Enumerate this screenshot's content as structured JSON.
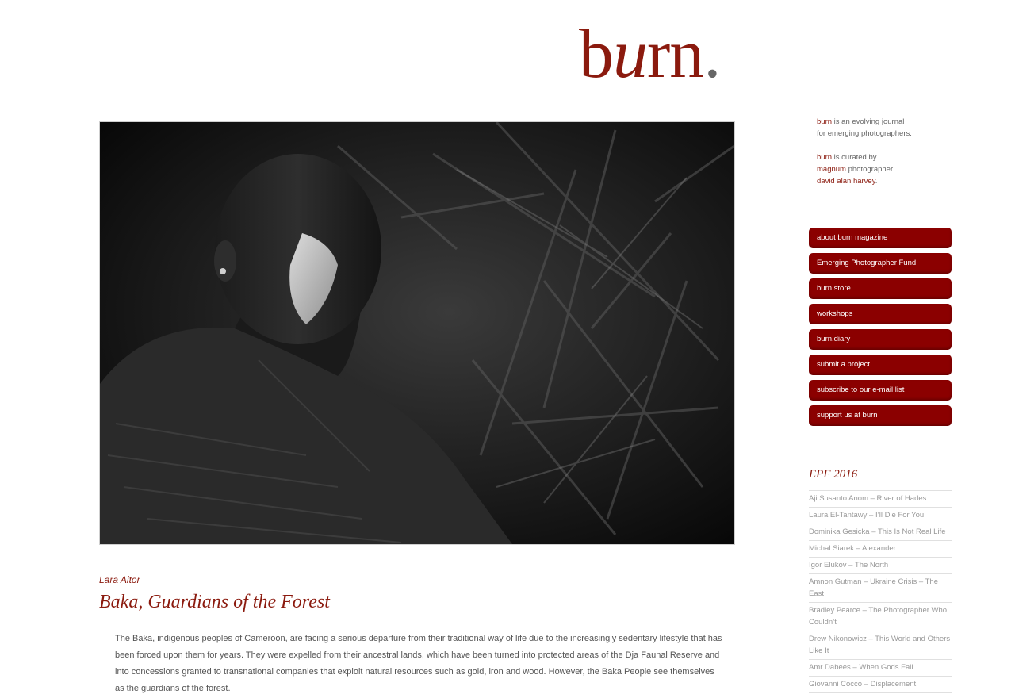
{
  "logo": {
    "b": "b",
    "u": "u",
    "rn": "rn",
    "dot": "."
  },
  "photo": {
    "alt": "Baka man in the forest"
  },
  "story": {
    "author": "Lara Aitor",
    "title": "Baka, Guardians of the Forest",
    "description": "The Baka, indigenous peoples of Cameroon, are facing a serious departure from their traditional way of life due to the increasingly sedentary lifestyle that has been forced upon them for years. They were expelled from their ancestral lands, which have been turned into protected areas of the Dja Faunal Reserve and into concessions granted to transnational companies that exploit natural resources such as gold, iron and wood. However, the Baka People see themselves as the guardians of the forest."
  },
  "intro": {
    "p1_link": "burn",
    "p1_text_a": " is an evolving journal",
    "p1_text_b": "for emerging photographers.",
    "p2_link1": "burn",
    "p2_text1": " is curated by",
    "p2_link2": "magnum",
    "p2_text2": " photographer",
    "p2_link3": "david alan harvey",
    "p2_text3": "."
  },
  "nav": {
    "items": [
      {
        "label": "about burn magazine"
      },
      {
        "label": "Emerging Photographer Fund"
      },
      {
        "label": "burn.store"
      },
      {
        "label": "workshops"
      },
      {
        "label": "burn.diary"
      },
      {
        "label": "submit a project"
      },
      {
        "label": "subscribe to our e-mail list"
      },
      {
        "label": "support us at burn"
      }
    ]
  },
  "epf": {
    "title": "EPF 2016",
    "items": [
      {
        "label": "Aji Susanto Anom – River of Hades"
      },
      {
        "label": "Laura El-Tantawy – I’ll Die For You"
      },
      {
        "label": "Dominika Gesicka – This Is Not Real Life"
      },
      {
        "label": "Michal Siarek – Alexander"
      },
      {
        "label": "Igor Elukov – The North"
      },
      {
        "label": "Amnon Gutman – Ukraine Crisis – The East"
      },
      {
        "label": "Bradley Pearce – The Photographer Who Couldn’t"
      },
      {
        "label": "Drew Nikonowicz – This World and Others Like It"
      },
      {
        "label": "Amr Dabees – When Gods Fall"
      },
      {
        "label": "Giovanni Cocco – Displacement"
      }
    ]
  },
  "colors": {
    "accent": "#8b1a0e",
    "nav_bg": "#8b0000",
    "muted": "#999999"
  }
}
